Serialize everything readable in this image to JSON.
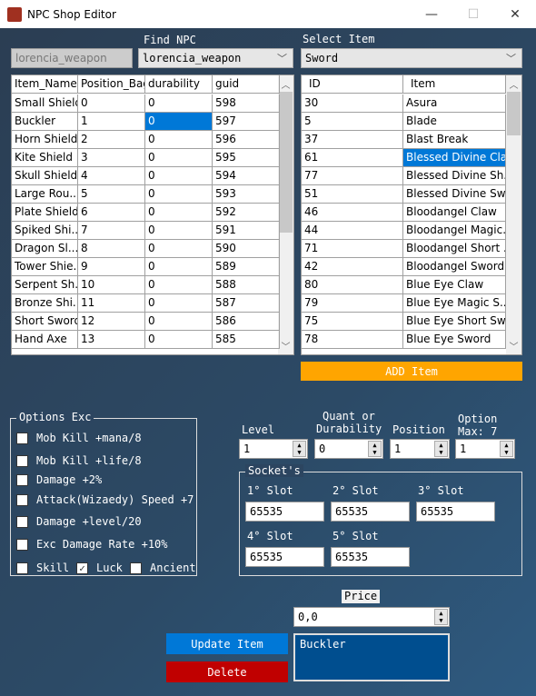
{
  "window": {
    "title": "NPC Shop Editor",
    "minimize": "—",
    "maximize": "☐",
    "close": "✕"
  },
  "npc_field": "lorencia_weapon",
  "find_npc": {
    "label": "Find NPC",
    "value": "lorencia_weapon"
  },
  "select_item": {
    "label": "Select Item",
    "value": "Sword"
  },
  "shop_table": {
    "columns": [
      "Item_Name",
      "Position_Bag",
      "durability",
      "guid"
    ],
    "rows": [
      [
        "Small Shield",
        "0",
        "0",
        "598"
      ],
      [
        "Buckler",
        "1",
        "0",
        "597"
      ],
      [
        "Horn Shield",
        "2",
        "0",
        "596"
      ],
      [
        "Kite Shield",
        "3",
        "0",
        "595"
      ],
      [
        "Skull Shield",
        "4",
        "0",
        "594"
      ],
      [
        "Large Rou...",
        "5",
        "0",
        "593"
      ],
      [
        "Plate Shield",
        "6",
        "0",
        "592"
      ],
      [
        "Spiked Shi...",
        "7",
        "0",
        "591"
      ],
      [
        "Dragon Sl...",
        "8",
        "0",
        "590"
      ],
      [
        "Tower Shie...",
        "9",
        "0",
        "589"
      ],
      [
        "Serpent Sh...",
        "10",
        "0",
        "588"
      ],
      [
        "Bronze Shi...",
        "11",
        "0",
        "587"
      ],
      [
        "Short Sword",
        "12",
        "0",
        "586"
      ],
      [
        "Hand Axe",
        "13",
        "0",
        "585"
      ]
    ]
  },
  "item_table": {
    "columns": [
      "ID",
      "Item"
    ],
    "rows": [
      [
        "30",
        "Asura"
      ],
      [
        "5",
        "Blade"
      ],
      [
        "37",
        "Blast Break"
      ],
      [
        "61",
        "Blessed Divine Cla..."
      ],
      [
        "77",
        "Blessed Divine Sh..."
      ],
      [
        "51",
        "Blessed Divine Sw..."
      ],
      [
        "46",
        "Bloodangel Claw"
      ],
      [
        "44",
        "Bloodangel Magic..."
      ],
      [
        "71",
        "Bloodangel Short ..."
      ],
      [
        "42",
        "Bloodangel Sword"
      ],
      [
        "80",
        "Blue Eye Claw"
      ],
      [
        "79",
        "Blue Eye Magic S..."
      ],
      [
        "75",
        "Blue Eye Short Sw..."
      ],
      [
        "78",
        "Blue Eye Sword"
      ]
    ]
  },
  "add_item": "ADD Item",
  "options_exc": {
    "title": "Options Exc",
    "items": [
      {
        "label": "Mob Kill +mana/8",
        "checked": false
      },
      {
        "label": "Mob Kill +life/8",
        "checked": false
      },
      {
        "label": "Damage +2%",
        "checked": false
      },
      {
        "label": "Attack(Wizaedy) Speed +7",
        "checked": false
      },
      {
        "label": "Damage +level/20",
        "checked": false
      },
      {
        "label": "Exc Damage Rate +10%",
        "checked": false
      }
    ],
    "skill": {
      "label": "Skill",
      "checked": false
    },
    "luck": {
      "label": "Luck",
      "checked": true
    },
    "ancient": {
      "label": "Ancient",
      "checked": false
    }
  },
  "level": {
    "label": "Level",
    "value": "1"
  },
  "quant": {
    "label1": "Quant or",
    "label2": "Durability",
    "value": "0"
  },
  "position": {
    "label": "Position",
    "value": "1"
  },
  "option": {
    "label1": "Option",
    "label2": "Max: 7",
    "value": "1"
  },
  "sockets": {
    "title": "Socket's",
    "slots": [
      {
        "label": "1° Slot",
        "value": "65535"
      },
      {
        "label": "2° Slot",
        "value": "65535"
      },
      {
        "label": "3° Slot",
        "value": "65535"
      },
      {
        "label": "4° Slot",
        "value": "65535"
      },
      {
        "label": "5° Slot",
        "value": "65535"
      }
    ]
  },
  "price": {
    "label": "Price",
    "value": "0,0"
  },
  "update_item": "Update Item",
  "delete": "Delete",
  "selected_name": "Buckler",
  "colors": {
    "add": "#ffa500",
    "update": "#0078d7",
    "delete": "#c00000",
    "name_box": "#004e8f",
    "selection": "#0078d7"
  }
}
